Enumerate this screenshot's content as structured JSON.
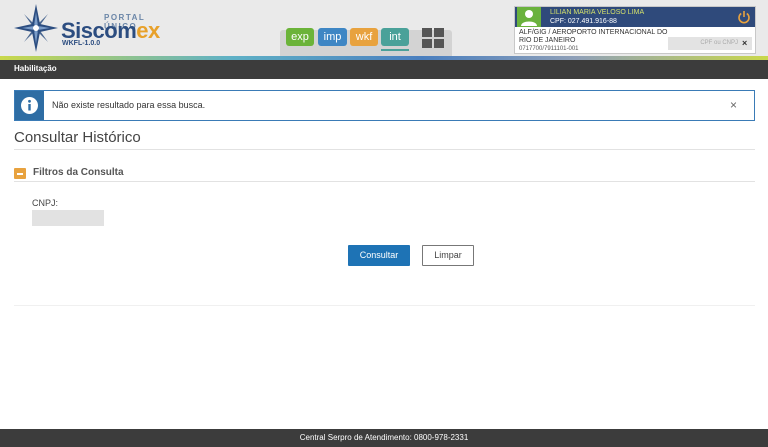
{
  "header": {
    "portal_label": "PORTAL ÚNICO",
    "brand_main": "Siscom",
    "brand_accent": "ex",
    "version": "WKFL-1.0.0",
    "modules": [
      {
        "label": "exp",
        "color": "#6bb339"
      },
      {
        "label": "imp",
        "color": "#3e86c4"
      },
      {
        "label": "wkf",
        "color": "#e8a23e"
      },
      {
        "label": "int",
        "color": "#4aa199",
        "active": true
      }
    ],
    "grid_icon": "apps-grid-icon"
  },
  "user": {
    "name": "LILIAN MARIA VELOSO LIMA",
    "cpf": "CPF: 027.491.916-88",
    "organization": "ALF/GIG / AEROPORTO INTERNACIONAL DO RIO DE JANEIRO",
    "code": "0717700/7911101-001",
    "cpf_placeholder": "CPF ou CNPJ",
    "avatar_icon": "user-icon",
    "power_icon": "power-icon"
  },
  "nav": {
    "section": "Habilitação"
  },
  "alert": {
    "message": "Não existe resultado para essa busca.",
    "icon": "info-icon",
    "close": "×"
  },
  "page": {
    "title": "Consultar Histórico"
  },
  "filters": {
    "title": "Filtros da Consulta",
    "cnpj_label": "CNPJ:",
    "cnpj_value": "",
    "consultar_label": "Consultar",
    "limpar_label": "Limpar"
  },
  "footer": {
    "text": "Central Serpro de Atendimento: 0800-978-2331"
  },
  "colors": {
    "primary": "#1e73b5",
    "navbar": "#3c3c3c",
    "accent_orange": "#e8a23e",
    "brand_blue": "#2c4d80"
  }
}
